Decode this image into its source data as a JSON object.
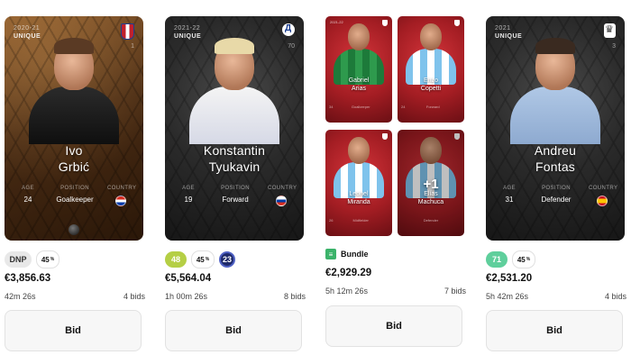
{
  "listings": [
    {
      "card": {
        "season": "2020-21",
        "rarity": "UNIQUE",
        "serial": "1",
        "first_name": "Ivo",
        "last_name": "Grbić",
        "age_label": "AGE",
        "age": "24",
        "position_label": "POSITION",
        "position": "Goalkeeper",
        "country_label": "COUNTRY"
      },
      "status_chip": "DNP",
      "pct_value": "45",
      "pct_sign": "%",
      "price": "€3,856.63",
      "time_left": "42m 26s",
      "bids": "4 bids",
      "bid_label": "Bid"
    },
    {
      "card": {
        "season": "2021-22",
        "rarity": "UNIQUE",
        "serial": "70",
        "first_name": "Konstantin",
        "last_name": "Tyukavin",
        "age_label": "AGE",
        "age": "19",
        "position_label": "POSITION",
        "position": "Forward",
        "country_label": "COUNTRY"
      },
      "score_chip": "48",
      "score_color": "#b5cf45",
      "pct_value": "45",
      "pct_sign": "%",
      "num_chip": "23",
      "price": "€5,564.04",
      "time_left": "1h 00m 26s",
      "bids": "8 bids",
      "bid_label": "Bid"
    },
    {
      "bundle_cards": [
        {
          "first_name": "Gabriel",
          "last_name": "Arias",
          "position": "Goalkeeper",
          "age": "34"
        },
        {
          "first_name": "Enzo",
          "last_name": "Copetti",
          "position": "Forward",
          "age": "24"
        },
        {
          "first_name": "Leonel",
          "last_name": "Miranda",
          "position": "Midfielder",
          "age": "26"
        },
        {
          "first_name": "Elías",
          "last_name": "Machuca",
          "position": "Defender",
          "age": "",
          "extra": "+1"
        }
      ],
      "bundle_label": "Bundle",
      "price": "€2,929.29",
      "time_left": "5h 12m 26s",
      "bids": "7 bids",
      "bid_label": "Bid"
    },
    {
      "card": {
        "season": "2021",
        "rarity": "UNIQUE",
        "serial": "3",
        "first_name": "Andreu",
        "last_name": "Fontas",
        "age_label": "AGE",
        "age": "31",
        "position_label": "POSITION",
        "position": "Defender",
        "country_label": "COUNTRY"
      },
      "score_chip": "71",
      "score_color": "#5fcf9c",
      "pct_value": "45",
      "pct_sign": "%",
      "price": "€2,531.20",
      "time_left": "5h 42m 26s",
      "bids": "4 bids",
      "bid_label": "Bid"
    }
  ]
}
